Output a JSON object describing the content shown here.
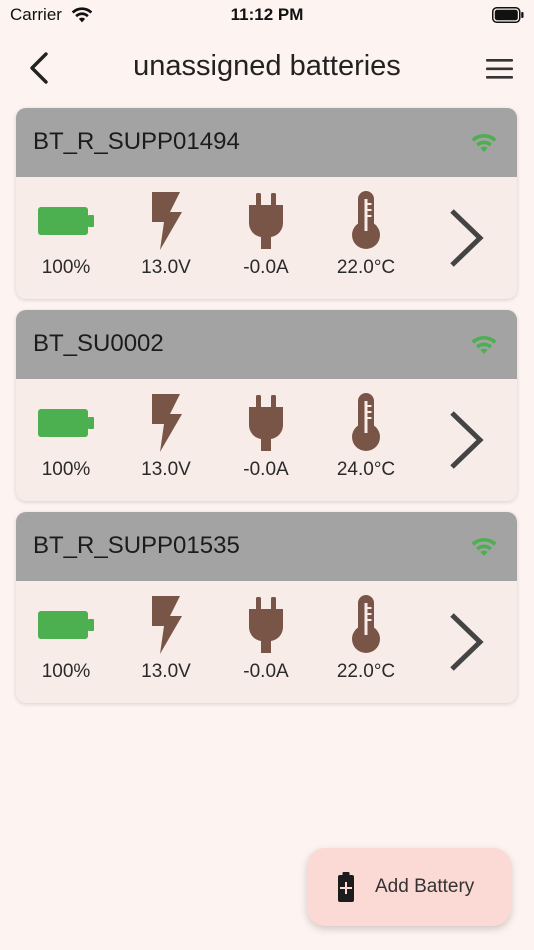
{
  "status_bar": {
    "carrier": "Carrier",
    "time": "11:12 PM"
  },
  "header": {
    "title": "unassigned batteries"
  },
  "colors": {
    "background": "#fdf3f0",
    "card_header": "#a3a3a3",
    "card_body": "#f7ece8",
    "battery_green": "#4caf50",
    "icon_brown": "#795548",
    "wifi_green": "#4caf50",
    "fab_bg": "#fbd9d4"
  },
  "batteries": [
    {
      "name": "BT_R_SUPP01494",
      "charge": "100%",
      "voltage": "13.0V",
      "current": "-0.0A",
      "temperature": "22.0°C"
    },
    {
      "name": "BT_SU0002",
      "charge": "100%",
      "voltage": "13.0V",
      "current": "-0.0A",
      "temperature": "24.0°C"
    },
    {
      "name": "BT_R_SUPP01535",
      "charge": "100%",
      "voltage": "13.0V",
      "current": "-0.0A",
      "temperature": "22.0°C"
    }
  ],
  "icons": {
    "back": "chevron-left-icon",
    "menu": "hamburger-menu-icon",
    "signal": "wifi-icon",
    "charge": "battery-full-icon",
    "voltage": "lightning-bolt-icon",
    "current": "power-plug-icon",
    "temperature": "thermometer-icon",
    "open": "chevron-right-icon",
    "add": "add-battery-icon"
  },
  "fab": {
    "label": "Add Battery"
  }
}
